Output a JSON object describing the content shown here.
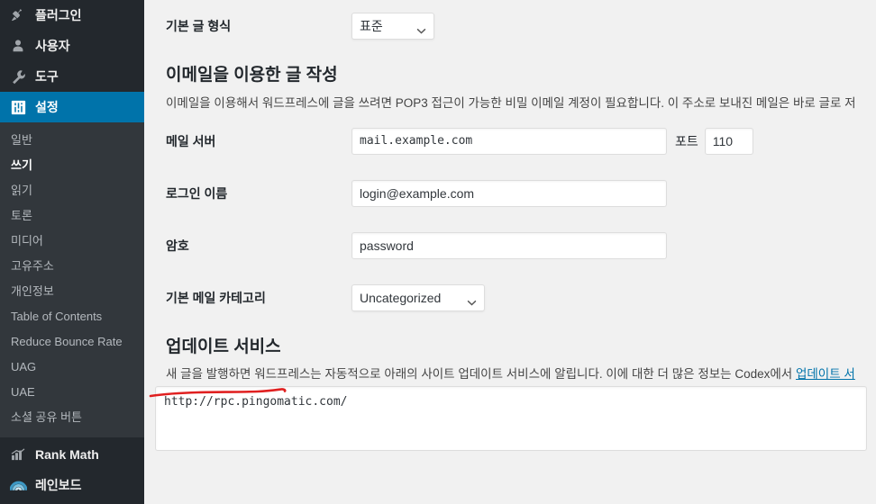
{
  "sidebar": {
    "top_items": [
      {
        "label": "플러그인",
        "icon": "plugin-icon",
        "active": false
      },
      {
        "label": "사용자",
        "icon": "user-icon",
        "active": false
      },
      {
        "label": "도구",
        "icon": "wrench-icon",
        "active": false
      },
      {
        "label": "설정",
        "icon": "settings-sliders-icon",
        "active": true
      }
    ],
    "submenu_items": [
      {
        "label": "일반",
        "current": false
      },
      {
        "label": "쓰기",
        "current": true
      },
      {
        "label": "읽기",
        "current": false
      },
      {
        "label": "토론",
        "current": false
      },
      {
        "label": "미디어",
        "current": false
      },
      {
        "label": "고유주소",
        "current": false
      },
      {
        "label": "개인정보",
        "current": false
      },
      {
        "label": "Table of Contents",
        "current": false
      },
      {
        "label": "Reduce Bounce Rate",
        "current": false
      },
      {
        "label": "UAG",
        "current": false
      },
      {
        "label": "UAE",
        "current": false
      },
      {
        "label": "소셜 공유 버튼",
        "current": false
      }
    ],
    "bottom_items": [
      {
        "label": "Rank Math",
        "icon": "bar-chart-icon"
      },
      {
        "label": "레인보드",
        "icon": "rainbow-icon"
      }
    ]
  },
  "main": {
    "default_post_format": {
      "label": "기본 글 형식",
      "value": "표준",
      "options": [
        "표준"
      ]
    },
    "email_section": {
      "heading": "이메일을 이용한 글 작성",
      "description": "이메일을 이용해서 워드프레스에 글을 쓰려면 POP3 접근이 가능한 비밀 이메일 계정이 필요합니다. 이 주소로 보내진 메일은 바로 글로 저",
      "mail_server": {
        "label": "메일 서버",
        "value": "mail.example.com",
        "port_label": "포트",
        "port_value": "110"
      },
      "login_name": {
        "label": "로그인 이름",
        "value": "login@example.com"
      },
      "password": {
        "label": "암호",
        "value": "password"
      },
      "default_mail_category": {
        "label": "기본 메일 카테고리",
        "value": "Uncategorized",
        "options": [
          "Uncategorized"
        ]
      }
    },
    "update_services": {
      "heading": "업데이트 서비스",
      "description_before": "새 글을 발행하면 워드프레스는 자동적으로 아래의 사이트 업데이트 서비스에 알립니다. 이에 대한 더 많은 정보는 Codex에서 ",
      "link_text": "업데이트 서",
      "textarea_value": "http://rpc.pingomatic.com/"
    }
  },
  "annotation": {
    "underline_color": "#e02020"
  }
}
